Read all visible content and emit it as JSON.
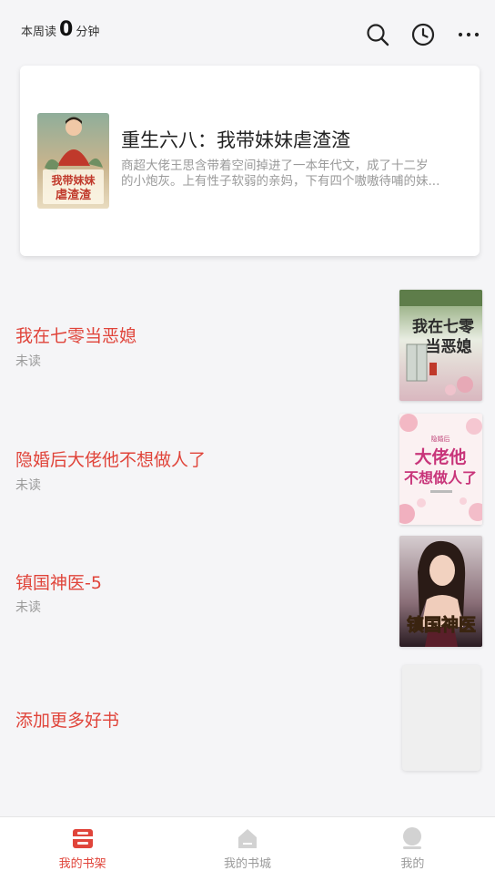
{
  "header": {
    "read_prefix": "本周读",
    "read_minutes": "0",
    "read_suffix": "分钟",
    "icons": [
      "search-icon",
      "history-clock-icon",
      "more-dots-icon"
    ]
  },
  "featured": {
    "title": "重生六八：我带妹妹虐渣渣",
    "desc_line1": "商超大佬王思含带着空间掉进了一本年代文，成了十二岁",
    "desc_line2": "的小炮灰。上有性子软弱的亲妈，下有四个嗷嗷待哺的妹...",
    "cover_text": "我带妹妹虐渣渣"
  },
  "books": [
    {
      "title": "我在七零当恶媳",
      "status": "未读",
      "cover_text": "我在七零当恶媳"
    },
    {
      "title": "隐婚后大佬他不想做人了",
      "status": "未读",
      "cover_text": "大佬他不想做人了"
    },
    {
      "title": "镇国神医-5",
      "status": "未读",
      "cover_text": "镇国神医"
    }
  ],
  "add_more": {
    "label": "添加更多好书"
  },
  "nav": {
    "tabs": [
      {
        "label": "我的书架",
        "icon": "bookshelf-icon",
        "active": true
      },
      {
        "label": "我的书城",
        "icon": "bookstore-icon",
        "active": false
      },
      {
        "label": "我的",
        "icon": "profile-icon",
        "active": false
      }
    ]
  },
  "colors": {
    "accent": "#e0443a",
    "muted": "#9a9a9a",
    "background": "#f5f5f7"
  }
}
